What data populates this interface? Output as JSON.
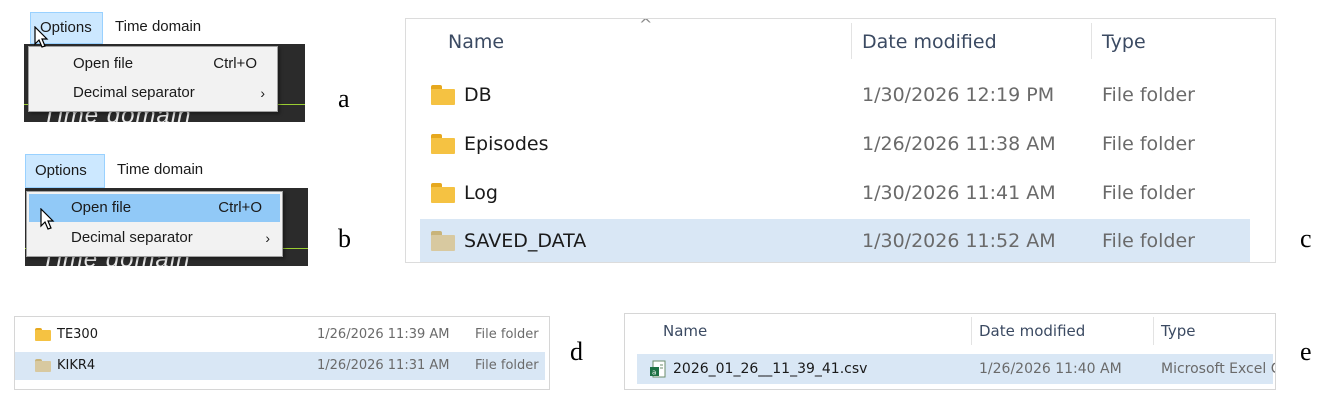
{
  "labels": {
    "a": "a",
    "b": "b",
    "c": "c",
    "d": "d",
    "e": "e"
  },
  "panel_a": {
    "menubar": [
      "Options",
      "Time domain"
    ],
    "items": [
      {
        "label": "Open file",
        "shortcut": "Ctrl+O"
      },
      {
        "label": "Decimal separator",
        "submenu": "›"
      }
    ],
    "background_text": "Time domain"
  },
  "panel_b": {
    "menubar": [
      "Options",
      "Time domain"
    ],
    "items": [
      {
        "label": "Open file",
        "shortcut": "Ctrl+O",
        "highlighted": true
      },
      {
        "label": "Decimal separator",
        "submenu": "›"
      }
    ],
    "background_text": "Time domain"
  },
  "panel_c": {
    "sort_arrow": "^",
    "columns": [
      "Name",
      "Date modified",
      "Type"
    ],
    "rows": [
      {
        "name": "DB",
        "date": "1/30/2026 12:19 PM",
        "type": "File folder"
      },
      {
        "name": "Episodes",
        "date": "1/26/2026 11:38 AM",
        "type": "File folder"
      },
      {
        "name": "Log",
        "date": "1/30/2026 11:41 AM",
        "type": "File folder"
      },
      {
        "name": "SAVED_DATA",
        "date": "1/30/2026 11:52 AM",
        "type": "File folder",
        "selected": true
      }
    ]
  },
  "panel_d": {
    "rows": [
      {
        "name": "TE300",
        "date": "1/26/2026 11:39 AM",
        "type": "File folder"
      },
      {
        "name": "KIKR4",
        "date": "1/26/2026 11:31 AM",
        "type": "File folder",
        "selected": true
      }
    ]
  },
  "panel_e": {
    "sort_arrow": "^",
    "columns": [
      "Name",
      "Date modified",
      "Type"
    ],
    "rows": [
      {
        "name": "2026_01_26__11_39_41.csv",
        "date": "1/26/2026 11:40 AM",
        "type": "Microsoft Excel C",
        "selected": true,
        "icon": "excel-csv-icon"
      }
    ]
  },
  "colors": {
    "selection": "#d9e7f5",
    "menu_highlight": "#91c9f7",
    "folder": "#f5c242",
    "folder_dim": "#d8c9a0"
  }
}
